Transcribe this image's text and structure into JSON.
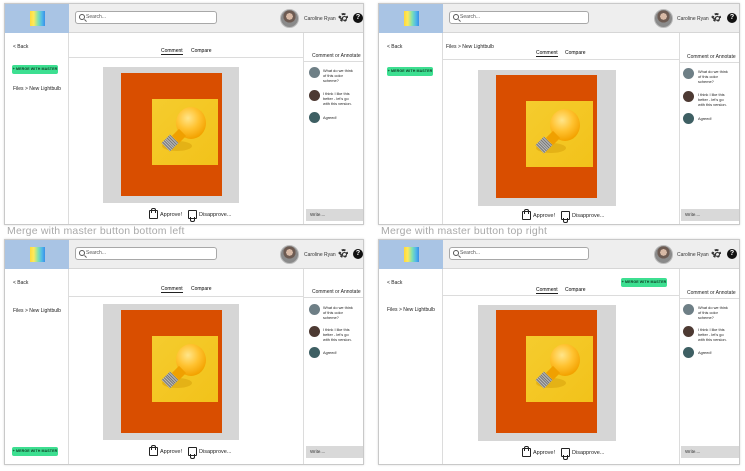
{
  "captions": {
    "bottom_left": "Merge with master button bottom left",
    "top_right": "Merge with master button top right"
  },
  "app": {
    "search_placeholder": "Search...",
    "user_name": "Caroline Ryan",
    "help_glyph": "?"
  },
  "nav": {
    "back": "< Back",
    "breadcrumb": "Files >  New Lightbulb"
  },
  "merge_button": "+ MERGE WITH MASTER",
  "tabs": {
    "comment": "Comment",
    "compare": "Compare"
  },
  "comments_panel": {
    "title": "Comment or Annotate",
    "comments": [
      {
        "text": "What do we think of this color scheme?"
      },
      {
        "text": "I think I like this better - let's go with this version."
      },
      {
        "text": "Agreed!"
      }
    ],
    "write_placeholder": "Write...."
  },
  "actions": {
    "approve": "Approve!",
    "disapprove": "Disapprove..."
  },
  "colors": {
    "accent_green": "#3ddf91",
    "canvas_orange": "#d94e00",
    "logo_bg": "#a9c4e4",
    "canvas_gray": "#d6d6d6"
  },
  "icons": [
    "search-icon",
    "chevron-down-icon",
    "gear-icon",
    "help-icon",
    "thumbs-up-icon",
    "thumbs-down-icon",
    "lightbulb-image"
  ]
}
